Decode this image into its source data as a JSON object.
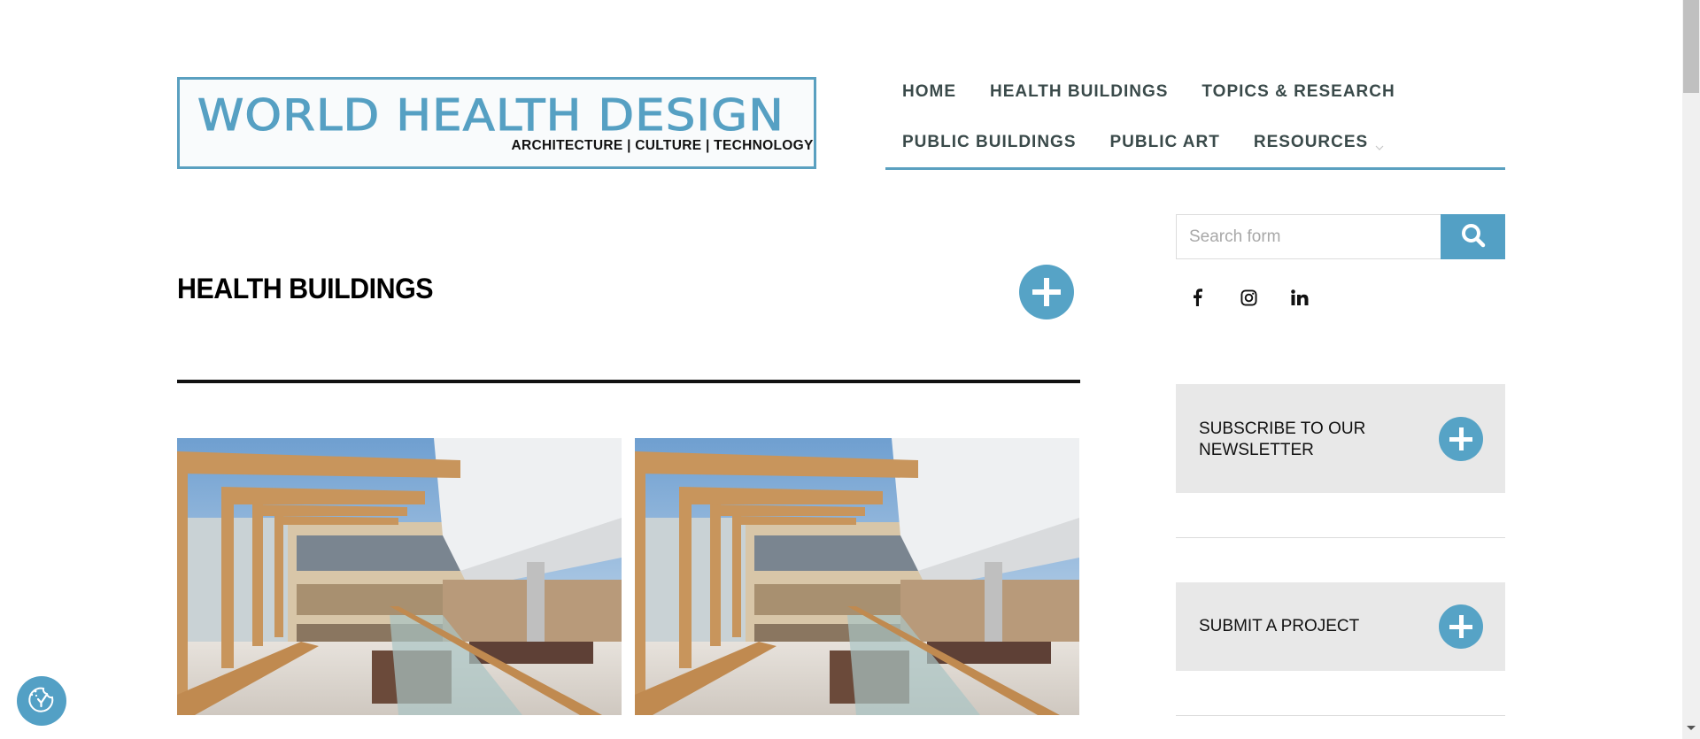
{
  "logo": {
    "title": "WORLD HEALTH DESIGN",
    "tagline": "ARCHITECTURE | CULTURE | TECHNOLOGY"
  },
  "nav": {
    "row1": [
      {
        "label": "HOME"
      },
      {
        "label": "HEALTH BUILDINGS"
      },
      {
        "label": "TOPICS & RESEARCH"
      }
    ],
    "row2": [
      {
        "label": "PUBLIC BUILDINGS"
      },
      {
        "label": "PUBLIC ART"
      },
      {
        "label": "RESOURCES",
        "icon": "chevron-down-icon"
      }
    ]
  },
  "section": {
    "title": "HEALTH BUILDINGS",
    "expand_icon": "plus-icon"
  },
  "images": [
    {
      "alt": "Atrium interior with timber beams and glass roof"
    },
    {
      "alt": "Atrium interior with timber beams and glass roof"
    }
  ],
  "sidebar": {
    "search": {
      "placeholder": "Search form",
      "value": "",
      "button_icon": "search-icon"
    },
    "social": [
      {
        "icon": "facebook-icon"
      },
      {
        "icon": "instagram-icon"
      },
      {
        "icon": "linkedin-icon"
      }
    ],
    "cards": [
      {
        "label": "SUBSCRIBE TO OUR NEWSLETTER",
        "icon": "plus-icon"
      },
      {
        "label": "SUBMIT A PROJECT",
        "icon": "plus-icon"
      }
    ]
  },
  "cookie": {
    "icon": "cookie-consent-icon"
  },
  "colors": {
    "accent": "#53a0c5",
    "nav_text": "#3a4a4a",
    "card_bg": "#e8e8e8"
  }
}
